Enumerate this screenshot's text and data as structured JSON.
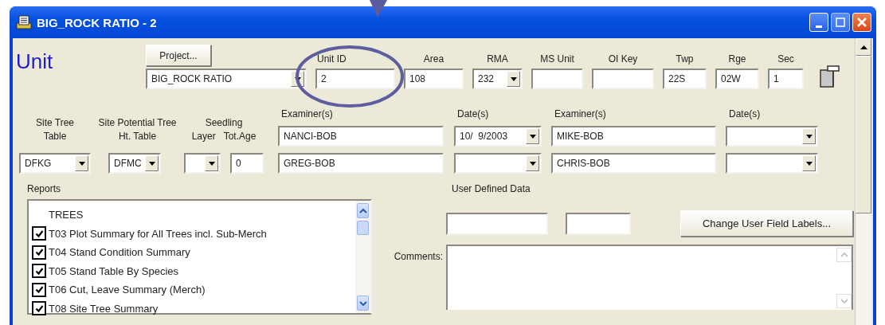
{
  "window": {
    "title": "BIG_ROCK RATIO - 2"
  },
  "heading": "Unit",
  "project_button": "Project...",
  "unit_fields": [
    {
      "kind": "combo",
      "value": "BIG_ROCK RATIO"
    },
    {
      "label": "Unit ID",
      "kind": "text",
      "value": "2"
    },
    {
      "label": "Area",
      "kind": "text",
      "value": "108"
    },
    {
      "label": "RMA",
      "kind": "combo",
      "value": "232"
    },
    {
      "label": "MS Unit",
      "kind": "text"
    },
    {
      "label": "OI Key",
      "kind": "text"
    },
    {
      "label": "Twp",
      "kind": "text",
      "value": "22S"
    },
    {
      "label": "Rge",
      "kind": "text",
      "value": "02W"
    },
    {
      "label": "Sec",
      "kind": "text",
      "value": "1"
    }
  ],
  "site_tree_table": {
    "label": "Site Tree Table",
    "value": "DFKG"
  },
  "site_potential_table": {
    "label": "Site Potential Tree Ht. Table",
    "value": "DFMC"
  },
  "seedling": {
    "label": "Seedling",
    "layer_label": "Layer",
    "age_label": "Tot.Age",
    "age_value": "0"
  },
  "examiners": [
    {
      "examiner_label": "Examiner(s)",
      "date_label": "Date(s)",
      "rows": [
        {
          "examiner": "NANCI-BOB",
          "date": "10/  9/2003"
        },
        {
          "examiner": "GREG-BOB"
        }
      ]
    },
    {
      "examiner_label": "Examiner(s)",
      "date_label": "Date(s)",
      "rows": [
        {
          "examiner": "MIKE-BOB"
        },
        {
          "examiner": "CHRIS-BOB"
        }
      ]
    }
  ],
  "reports": {
    "label": "Reports",
    "items": [
      {
        "kind": "header",
        "text": "TREES"
      },
      {
        "kind": "check",
        "text": "T03 Plot Summary for All Trees incl. Sub-Merch",
        "checked": true
      },
      {
        "kind": "check",
        "text": "T04 Stand Condition Summary",
        "checked": true
      },
      {
        "kind": "check",
        "text": "T05 Stand Table By Species",
        "checked": true
      },
      {
        "kind": "check",
        "text": "T06 Cut, Leave Summary (Merch)",
        "checked": true
      },
      {
        "kind": "check",
        "text": "T08 Site Tree Summary",
        "checked": true
      }
    ]
  },
  "user_defined": {
    "label": "User Defined Data",
    "fields": [
      {
        "kind": "text"
      },
      {
        "kind": "text"
      }
    ],
    "button": "Change User Field Labels..."
  },
  "comments": {
    "label": "Comments:"
  }
}
